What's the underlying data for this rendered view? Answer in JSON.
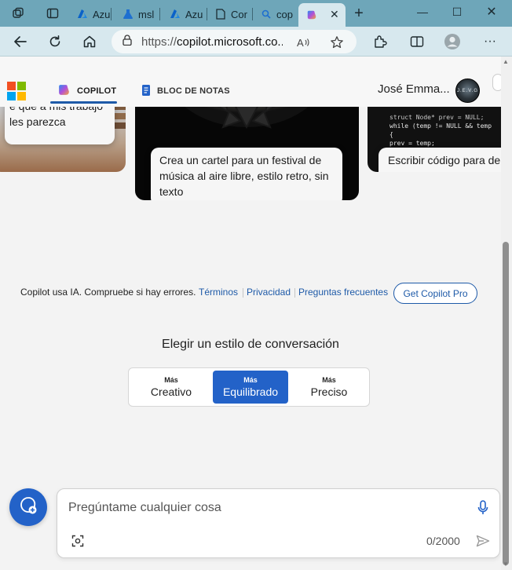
{
  "browser": {
    "tabs": [
      {
        "label": "Azu",
        "favicon": "azure-icon"
      },
      {
        "label": "msl",
        "favicon": "flask-icon"
      },
      {
        "label": "Azu",
        "favicon": "azure-icon"
      },
      {
        "label": "Cor",
        "favicon": "document-icon"
      },
      {
        "label": "cop",
        "favicon": "search-icon"
      },
      {
        "label": "",
        "favicon": "copilot-icon",
        "active": true
      }
    ],
    "address": {
      "scheme": "https://",
      "host": "copilot.microsoft.co..."
    }
  },
  "header": {
    "tabs": [
      {
        "label": "COPILOT",
        "icon": "copilot-icon",
        "active": true
      },
      {
        "label": "BLOC DE NOTAS",
        "icon": "notebook-icon",
        "active": false
      }
    ],
    "user_name": "José Emma...",
    "avatar_text": "J.E.V.G"
  },
  "cards": [
    {
      "caption": "e que a mis trabajo les parezca",
      "image": "hands-books"
    },
    {
      "caption": "Crea un cartel para un festival de música al aire libre, estilo retro, sin texto",
      "image": "mandala"
    },
    {
      "caption": "Escribir código para de lista enlazada en funcionalidades para",
      "image": "code"
    }
  ],
  "code_snippet": [
    "struct Node* prev = NULL;",
    "while (temp != NULL && temp",
    "{",
    "    prev = temp;"
  ],
  "footer": {
    "disclaimer": "Copilot usa IA. Compruebe si hay errores.",
    "links": [
      "Términos",
      "Privacidad",
      "Preguntas frecuentes"
    ],
    "pro_button": "Get Copilot Pro"
  },
  "conversation_style": {
    "title": "Elegir un estilo de conversación",
    "options": [
      {
        "small": "Más",
        "large": "Creativo",
        "selected": false
      },
      {
        "small": "Más",
        "large": "Equilibrado",
        "selected": true
      },
      {
        "small": "Más",
        "large": "Preciso",
        "selected": false
      }
    ]
  },
  "chat": {
    "placeholder": "Pregúntame cualquier cosa",
    "counter": "0/2000"
  },
  "colors": {
    "tabbar": "#6ea6b9",
    "toolbar": "#d7e8ee",
    "accent": "#2362c8",
    "link": "#1e5aa8"
  }
}
